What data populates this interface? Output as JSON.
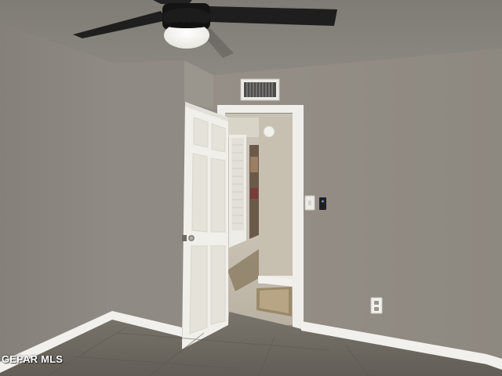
{
  "photo": {
    "subject": "empty-bedroom-with-open-door",
    "watermark_text": "GEPAR MLS"
  },
  "palette": {
    "ceiling": "#85817a",
    "wall_left": "#8b8780",
    "wall_back": "#938e86",
    "wall_corner": "#9a958d",
    "floor_tile": "#6f6a62",
    "trim": "#f2f0ec",
    "door": "#f1efe9",
    "fan_blade": "#1d1d1d",
    "fan_light": "#f7f7f2"
  },
  "icons": {
    "ceiling_fan": "ceiling-fan-icon",
    "air_vent": "air-vent-icon",
    "light_switch": "light-switch-icon",
    "thermostat": "thermostat-icon",
    "outlet": "outlet-icon",
    "door_knob": "door-knob-icon",
    "smoke_detector": "smoke-detector-icon"
  }
}
